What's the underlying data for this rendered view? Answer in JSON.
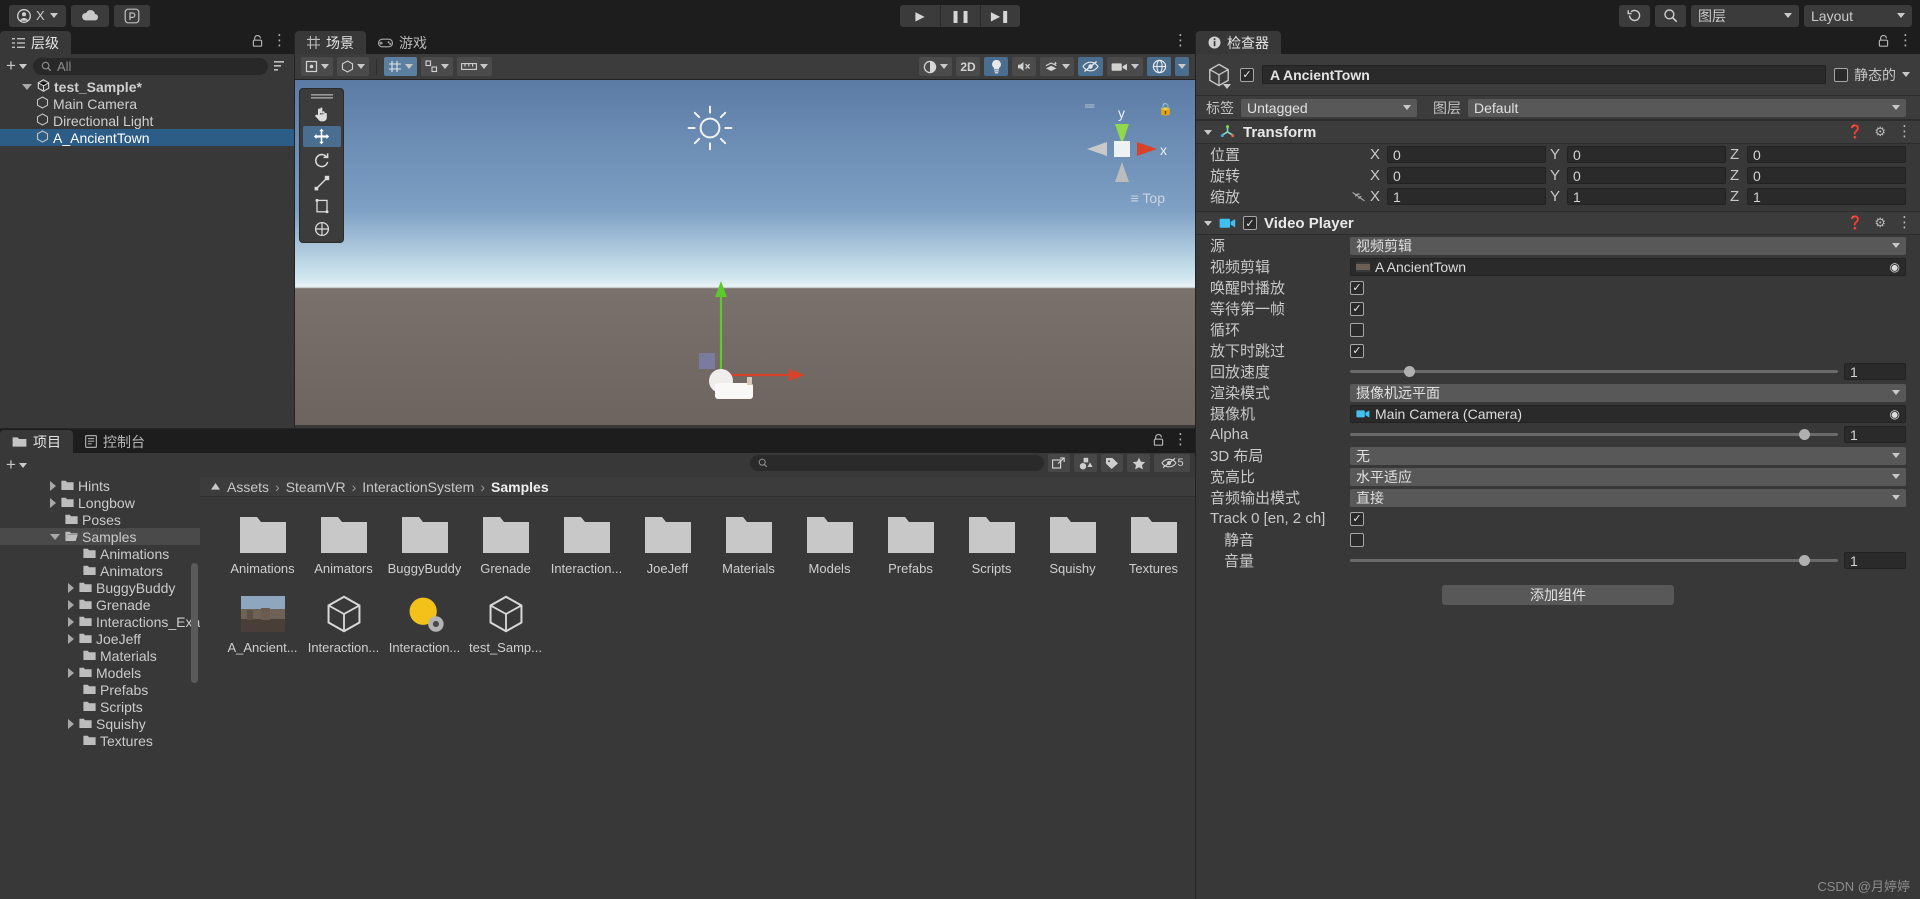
{
  "toolbar": {
    "account_label": "X",
    "cloud_icon": "cloud-icon",
    "collab_icon": "collab-icon",
    "play_label": "▶",
    "pause_label": "❚❚",
    "step_label": "▶❚",
    "history_icon": "undo-history-icon",
    "search_icon": "search-icon",
    "layers_label": "图层",
    "layout_label": "Layout"
  },
  "hierarchy": {
    "tab_label": "层级",
    "tab_icon": "hierarchy-icon",
    "add_label": "+",
    "search_placeholder": "All",
    "items": [
      {
        "label": "test_Sample*",
        "depth": 0,
        "expanded": true,
        "selected": false,
        "icon": "unity-scene-icon"
      },
      {
        "label": "Main Camera",
        "depth": 1,
        "expanded": false,
        "selected": false,
        "icon": "gameobject-icon"
      },
      {
        "label": "Directional Light",
        "depth": 1,
        "expanded": false,
        "selected": false,
        "icon": "gameobject-icon"
      },
      {
        "label": "A_AncientTown",
        "depth": 1,
        "expanded": false,
        "selected": true,
        "icon": "gameobject-icon"
      }
    ]
  },
  "scene": {
    "tabs": [
      {
        "label": "场景",
        "icon": "scene-grid-icon",
        "active": true
      },
      {
        "label": "游戏",
        "icon": "game-icon",
        "active": false
      }
    ],
    "tools": [
      {
        "name": "hand-tool",
        "glyph": "✋",
        "active": false
      },
      {
        "name": "move-tool",
        "glyph": "✛",
        "active": true
      },
      {
        "name": "rotate-tool",
        "glyph": "↻",
        "active": false
      },
      {
        "name": "scale-tool",
        "glyph": "⤡",
        "active": false
      },
      {
        "name": "rect-tool",
        "glyph": "▢",
        "active": false
      },
      {
        "name": "transform-tool",
        "glyph": "⊕",
        "active": false
      }
    ],
    "toolbar_buttons": [
      {
        "name": "pivot-mode",
        "label": "中心",
        "glyph": "⌗"
      },
      {
        "name": "handle-mode",
        "label": "全局",
        "glyph": "⊞"
      },
      {
        "name": "grid-snap",
        "label": "",
        "glyph": "‖"
      },
      {
        "name": "shading-mode",
        "label": "",
        "glyph": "◑"
      },
      {
        "name": "2d-toggle",
        "label": "2D",
        "glyph": ""
      },
      {
        "name": "lighting-toggle",
        "label": "",
        "glyph": "💡"
      },
      {
        "name": "audio-toggle",
        "label": "",
        "glyph": "🔇"
      },
      {
        "name": "effects-toggle",
        "label": "",
        "glyph": "✦"
      },
      {
        "name": "hidden-objects-toggle",
        "label": "",
        "glyph": "👁"
      },
      {
        "name": "camera-toggle",
        "label": "",
        "glyph": "🎥"
      },
      {
        "name": "gizmos-toggle",
        "label": "",
        "glyph": "◎"
      }
    ],
    "axis_labels": {
      "y": "y",
      "x": "x"
    },
    "view_label": "Top",
    "lock_icon": "lock-icon"
  },
  "inspector": {
    "tab_label": "检查器",
    "tab_icon": "info-icon",
    "lock_icon": "lock-icon",
    "object_name": "A AncientTown",
    "object_enabled": true,
    "static_label": "静态的",
    "tag_label": "标签",
    "tag_value": "Untagged",
    "layer_label": "图层",
    "layer_value": "Default",
    "transform": {
      "title": "Transform",
      "icon": "transform-icon",
      "rows": [
        {
          "label": "位置",
          "x": "0",
          "y": "0",
          "z": "0",
          "lock": false
        },
        {
          "label": "旋转",
          "x": "0",
          "y": "0",
          "z": "0",
          "lock": false
        },
        {
          "label": "缩放",
          "x": "1",
          "y": "1",
          "z": "1",
          "lock": true
        }
      ],
      "axis": {
        "x": "X",
        "y": "Y",
        "z": "Z"
      }
    },
    "video_player": {
      "title": "Video Player",
      "icon": "video-player-icon",
      "enabled": true,
      "fields": [
        {
          "kind": "dropdown",
          "label": "源",
          "value": "视频剪辑"
        },
        {
          "kind": "object",
          "label": "视频剪辑",
          "value": "A AncientTown",
          "icon": "video-clip-icon"
        },
        {
          "kind": "checkbox",
          "label": "唤醒时播放",
          "checked": true
        },
        {
          "kind": "checkbox",
          "label": "等待第一帧",
          "checked": true
        },
        {
          "kind": "checkbox",
          "label": "循环",
          "checked": false
        },
        {
          "kind": "checkbox",
          "label": "放下时跳过",
          "checked": true
        },
        {
          "kind": "slider",
          "label": "回放速度",
          "value": "1",
          "pct": 12
        },
        {
          "kind": "dropdown",
          "label": "渲染模式",
          "value": "摄像机远平面"
        },
        {
          "kind": "object",
          "label": "摄像机",
          "value": "Main Camera (Camera)",
          "icon": "camera-icon"
        },
        {
          "kind": "slider",
          "label": "Alpha",
          "value": "1",
          "pct": 93
        },
        {
          "kind": "dropdown",
          "label": "3D 布局",
          "value": "无"
        },
        {
          "kind": "dropdown",
          "label": "宽高比",
          "value": "水平适应"
        },
        {
          "kind": "dropdown",
          "label": "音频输出模式",
          "value": "直接"
        },
        {
          "kind": "checkbox",
          "label": "Track 0 [en, 2 ch]",
          "checked": true
        },
        {
          "kind": "checkbox",
          "label": "静音",
          "checked": false,
          "indent": true
        },
        {
          "kind": "slider",
          "label": "音量",
          "value": "1",
          "pct": 93,
          "indent": true
        }
      ]
    },
    "add_component_label": "添加组件"
  },
  "project": {
    "tabs": [
      {
        "label": "项目",
        "icon": "folder-icon",
        "active": true
      },
      {
        "label": "控制台",
        "icon": "console-icon",
        "active": false
      }
    ],
    "add_label": "+",
    "search_placeholder": "",
    "filter_icons": [
      "save-search-icon",
      "type-filter-icon",
      "label-filter-icon",
      "favorite-icon",
      "hidden-filter-icon"
    ],
    "hidden_count": "5",
    "tree": [
      {
        "label": "Hints",
        "depth": 2,
        "arrow": true,
        "selected": false
      },
      {
        "label": "Longbow",
        "depth": 2,
        "arrow": true,
        "selected": false
      },
      {
        "label": "Poses",
        "depth": 2,
        "arrow": false,
        "selected": false
      },
      {
        "label": "Samples",
        "depth": 2,
        "arrow": true,
        "expanded": true,
        "selected": true
      },
      {
        "label": "Animations",
        "depth": 3,
        "arrow": false,
        "selected": false
      },
      {
        "label": "Animators",
        "depth": 3,
        "arrow": false,
        "selected": false
      },
      {
        "label": "BuggyBuddy",
        "depth": 3,
        "arrow": true,
        "selected": false
      },
      {
        "label": "Grenade",
        "depth": 3,
        "arrow": true,
        "selected": false
      },
      {
        "label": "Interactions_Exan",
        "depth": 3,
        "arrow": true,
        "selected": false
      },
      {
        "label": "JoeJeff",
        "depth": 3,
        "arrow": true,
        "selected": false
      },
      {
        "label": "Materials",
        "depth": 3,
        "arrow": false,
        "selected": false
      },
      {
        "label": "Models",
        "depth": 3,
        "arrow": true,
        "selected": false
      },
      {
        "label": "Prefabs",
        "depth": 3,
        "arrow": false,
        "selected": false
      },
      {
        "label": "Scripts",
        "depth": 3,
        "arrow": false,
        "selected": false
      },
      {
        "label": "Squishy",
        "depth": 3,
        "arrow": true,
        "selected": false
      },
      {
        "label": "Textures",
        "depth": 3,
        "arrow": false,
        "selected": false
      }
    ],
    "breadcrumb": [
      "Assets",
      "SteamVR",
      "InteractionSystem",
      "Samples"
    ],
    "assets": [
      {
        "label": "Animations",
        "type": "folder"
      },
      {
        "label": "Animators",
        "type": "folder"
      },
      {
        "label": "BuggyBuddy",
        "type": "folder"
      },
      {
        "label": "Grenade",
        "type": "folder"
      },
      {
        "label": "Interaction...",
        "type": "folder"
      },
      {
        "label": "JoeJeff",
        "type": "folder"
      },
      {
        "label": "Materials",
        "type": "folder"
      },
      {
        "label": "Models",
        "type": "folder"
      },
      {
        "label": "Prefabs",
        "type": "folder"
      },
      {
        "label": "Scripts",
        "type": "folder"
      },
      {
        "label": "Squishy",
        "type": "folder"
      },
      {
        "label": "Textures",
        "type": "folder"
      },
      {
        "label": "A_Ancient...",
        "type": "video"
      },
      {
        "label": "Interaction...",
        "type": "prefab"
      },
      {
        "label": "Interaction...",
        "type": "material"
      },
      {
        "label": "test_Samp...",
        "type": "prefab"
      }
    ]
  },
  "watermark": "CSDN @月婷婷"
}
